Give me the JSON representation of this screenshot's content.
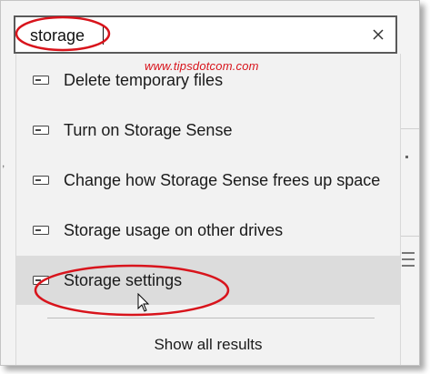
{
  "search": {
    "value": "storage"
  },
  "watermark": "www.tipsdotcom.com",
  "results": [
    {
      "label": "Delete temporary files",
      "icon": "drive-icon"
    },
    {
      "label": "Turn on Storage Sense",
      "icon": "drive-icon"
    },
    {
      "label": "Change how Storage Sense frees up space",
      "icon": "drive-icon"
    },
    {
      "label": "Storage usage on other drives",
      "icon": "drive-icon"
    },
    {
      "label": "Storage settings",
      "icon": "drive-icon",
      "hovered": true
    }
  ],
  "show_all_label": "Show all results",
  "colors": {
    "annotation": "#d8141c",
    "hover": "#dcdcdc",
    "panel": "#f2f2f2"
  }
}
